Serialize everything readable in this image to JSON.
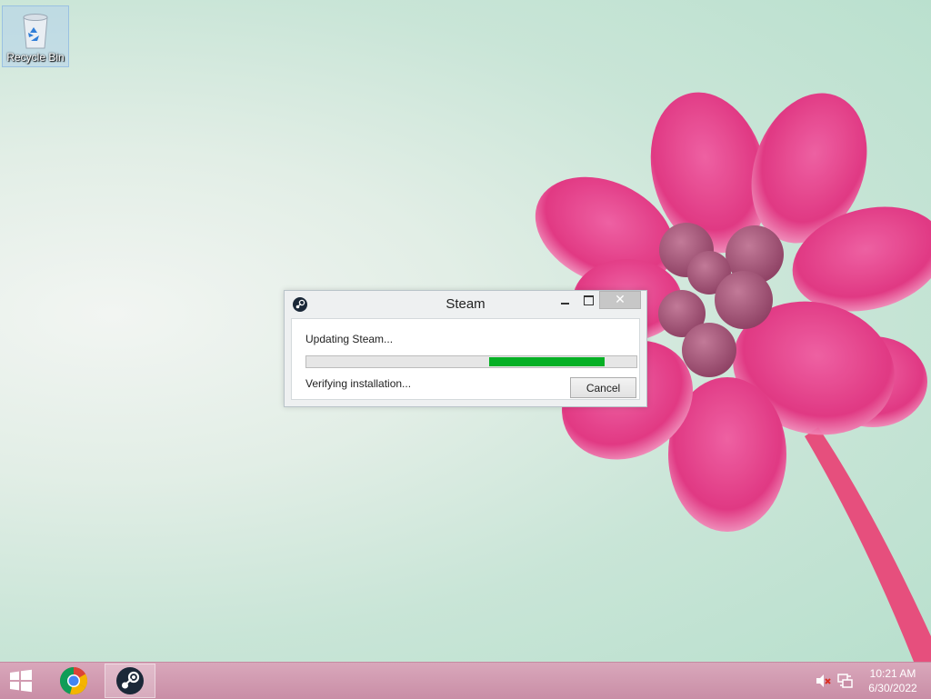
{
  "desktop": {
    "icons": [
      {
        "label": "Recycle Bin",
        "icon": "recycle-bin-icon"
      }
    ]
  },
  "dialog": {
    "title": "Steam",
    "app_icon": "steam-icon",
    "status_top": "Updating Steam...",
    "progress_fraction": 0.35,
    "progress_start_fraction": 0.555,
    "progress_color": "#06b025",
    "status_bottom": "Verifying installation...",
    "cancel_label": "Cancel",
    "window_controls": [
      "minimize-icon",
      "maximize-icon",
      "close-icon"
    ]
  },
  "taskbar": {
    "start_icon": "windows-logo-icon",
    "pinned": [
      {
        "name": "chrome",
        "icon": "chrome-icon"
      },
      {
        "name": "steam",
        "icon": "steam-icon",
        "active": true
      }
    ],
    "tray": {
      "volume_icon": "volume-muted-icon",
      "network_icon": "network-icon",
      "time": "10:21 AM",
      "date": "6/30/2022"
    },
    "color": "#d19ab1"
  }
}
